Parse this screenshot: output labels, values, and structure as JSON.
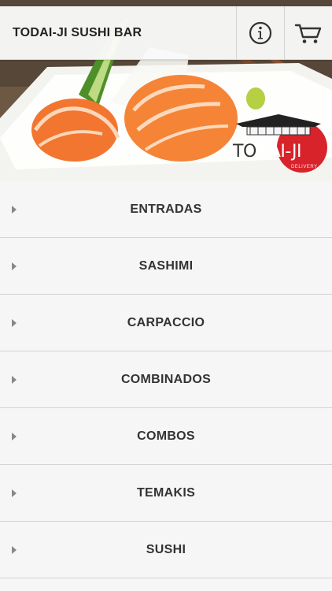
{
  "header": {
    "title": "TODAI-JI SUSHI BAR",
    "info_icon": "info-icon",
    "cart_icon": "cart-icon"
  },
  "banner": {
    "logo_text_1": "TO",
    "logo_text_2": "DAI-JI",
    "logo_subtext": "DELIVERY"
  },
  "menu": {
    "items": [
      {
        "label": "ENTRADAS"
      },
      {
        "label": "SASHIMI"
      },
      {
        "label": "CARPACCIO"
      },
      {
        "label": "COMBINADOS"
      },
      {
        "label": "COMBOS"
      },
      {
        "label": "TEMAKIS"
      },
      {
        "label": "SUSHI"
      }
    ]
  },
  "colors": {
    "accent_red": "#d8232a",
    "salmon": "#f47a3a",
    "background": "#f6f6f6"
  }
}
